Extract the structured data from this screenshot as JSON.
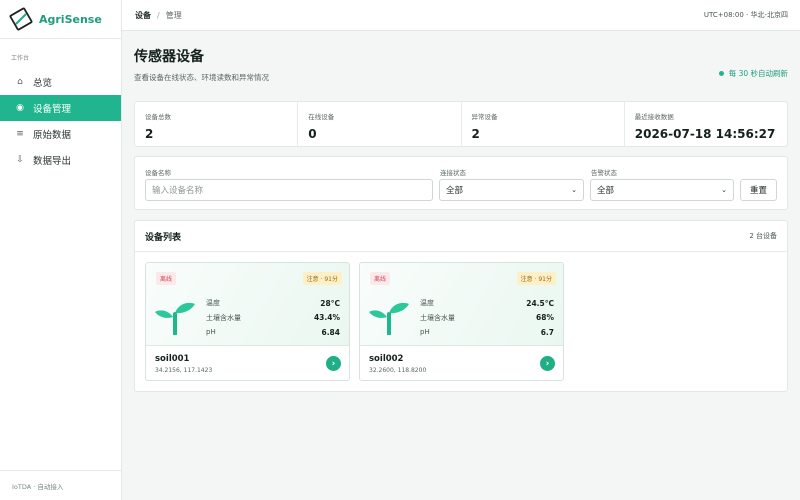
{
  "brand": {
    "name": "AgriSense"
  },
  "sidebar": {
    "section_label": "工作台",
    "items": [
      {
        "label": "总览",
        "icon": "home-icon",
        "active": false
      },
      {
        "label": "设备管理",
        "icon": "target-icon",
        "active": true
      },
      {
        "label": "原始数据",
        "icon": "list-icon",
        "active": false
      },
      {
        "label": "数据导出",
        "icon": "download-icon",
        "active": false
      }
    ],
    "footer": "IoTDA · 自动接入"
  },
  "topbar": {
    "breadcrumb": [
      "设备",
      "管理"
    ],
    "separator": "/",
    "timezone": "UTC+08:00 · 华北-北京四"
  },
  "page": {
    "title": "传感器设备",
    "subtitle": "查看设备在线状态、环境读数和异常情况",
    "refresh_text": "每 30 秒自动刷新"
  },
  "stats": [
    {
      "label": "设备总数",
      "value": "2"
    },
    {
      "label": "在线设备",
      "value": "0"
    },
    {
      "label": "异常设备",
      "value": "2"
    },
    {
      "label": "最近接收数据",
      "value": "2026-07-18 14:56:27"
    }
  ],
  "filters": {
    "name_label": "设备名称",
    "name_placeholder": "输入设备名称",
    "conn_label": "连接状态",
    "conn_value": "全部",
    "alert_label": "告警状态",
    "alert_value": "全部",
    "reset_label": "重置"
  },
  "device_list": {
    "title": "设备列表",
    "count_text": "2 台设备",
    "devices": [
      {
        "status": "离线",
        "alert": "注意 · 91分",
        "metrics": [
          {
            "label": "温度",
            "value": "28°C"
          },
          {
            "label": "土壤含水量",
            "value": "43.4%"
          },
          {
            "label": "pH",
            "value": "6.84"
          }
        ],
        "name": "soil001",
        "coords": "34.2156, 117.1423"
      },
      {
        "status": "离线",
        "alert": "注意 · 91分",
        "metrics": [
          {
            "label": "温度",
            "value": "24.5°C"
          },
          {
            "label": "土壤含水量",
            "value": "68%"
          },
          {
            "label": "pH",
            "value": "6.7"
          }
        ],
        "name": "soil002",
        "coords": "32.2600, 118.8200"
      }
    ]
  },
  "colors": {
    "accent": "#20b58e",
    "offline_badge_bg": "#fde8ea",
    "warn_badge_bg": "#fdf0c7"
  }
}
